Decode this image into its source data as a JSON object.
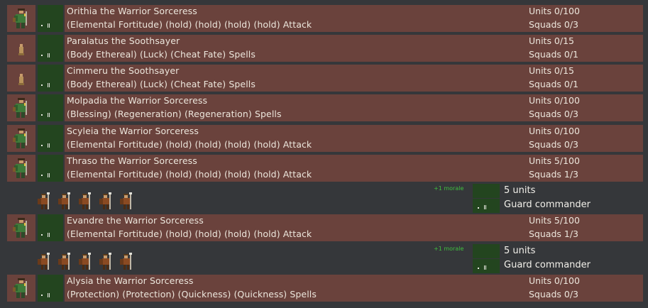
{
  "commanders": [
    {
      "name": "Orithia the Warrior Sorceress",
      "details": "(Elemental Fortitude) (hold) (hold) (hold) (hold) Attack",
      "units": "Units 0/100",
      "squads": "Squads 0/3",
      "portrait": "warrior-sorceress"
    },
    {
      "name": "Paralatus the Soothsayer",
      "details": "(Body Ethereal) (Luck) (Cheat Fate) Spells",
      "units": "Units 0/15",
      "squads": "Squads 0/1",
      "portrait": "soothsayer"
    },
    {
      "name": "Cimmeru the Soothsayer",
      "details": "(Body Ethereal) (Luck) (Cheat Fate) Spells",
      "units": "Units 0/15",
      "squads": "Squads 0/1",
      "portrait": "soothsayer"
    },
    {
      "name": "Molpadia the Warrior Sorceress",
      "details": "(Blessing) (Regeneration) (Regeneration) Spells",
      "units": "Units 0/100",
      "squads": "Squads 0/3",
      "portrait": "warrior-sorceress"
    },
    {
      "name": "Scyleia the Warrior Sorceress",
      "details": "(Elemental Fortitude) (hold) (hold) (hold) (hold) Attack",
      "units": "Units 0/100",
      "squads": "Squads 0/3",
      "portrait": "warrior-sorceress"
    },
    {
      "name": "Thraso the Warrior Sorceress",
      "details": "(Elemental Fortitude) (hold) (hold) (hold) (hold) Attack",
      "units": "Units 5/100",
      "squads": "Squads 1/3",
      "portrait": "warrior-sorceress"
    },
    {
      "name": "Evandre the Warrior Sorceress",
      "details": "(Elemental Fortitude) (hold) (hold) (hold) (hold) Attack",
      "units": "Units 5/100",
      "squads": "Squads 1/3",
      "portrait": "warrior-sorceress"
    },
    {
      "name": "Alysia the Warrior Sorceress",
      "details": "(Protection) (Protection) (Quickness) (Quickness) Spells",
      "units": "Units 0/100",
      "squads": "Squads 0/3",
      "portrait": "warrior-sorceress"
    }
  ],
  "squads": [
    {
      "morale": "+1 morale",
      "count": "5 units",
      "order": "Guard commander",
      "soldier_count": 5
    },
    {
      "morale": "+1 morale",
      "count": "5 units",
      "order": "Guard commander",
      "soldier_count": 5
    }
  ],
  "colors": {
    "background": "#35373a",
    "row": "#6a423c",
    "tile": "#23451f",
    "morale": "#3fbf3f",
    "text": "#ece6dc"
  }
}
